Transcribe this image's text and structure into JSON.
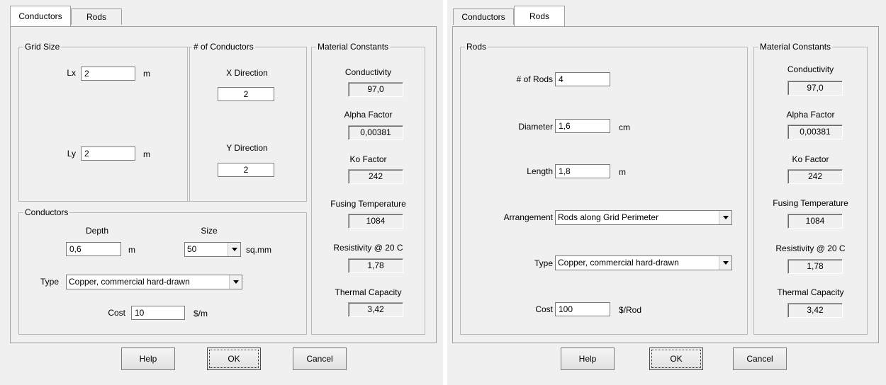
{
  "left_dialog": {
    "tabs": [
      "Conductors",
      "Rods"
    ],
    "grid_size": {
      "title": "Grid Size",
      "lx_label": "Lx",
      "lx_value": "2",
      "lx_unit": "m",
      "ly_label": "Ly",
      "ly_value": "2",
      "ly_unit": "m"
    },
    "num_conductors": {
      "title": "# of Conductors",
      "x_label": "X Direction",
      "x_value": "2",
      "y_label": "Y Direction",
      "y_value": "2"
    },
    "conductors": {
      "title": "Conductors",
      "depth_label": "Depth",
      "depth_value": "0,6",
      "depth_unit": "m",
      "size_label": "Size",
      "size_value": "50",
      "size_unit": "sq.mm",
      "type_label": "Type",
      "type_value": "Copper, commercial hard-drawn",
      "cost_label": "Cost",
      "cost_value": "10",
      "cost_unit": "$/m"
    },
    "buttons": {
      "help": "Help",
      "ok": "OK",
      "cancel": "Cancel"
    }
  },
  "right_dialog": {
    "tabs": [
      "Conductors",
      "Rods"
    ],
    "rods": {
      "title": "Rods",
      "num_label": "# of Rods",
      "num_value": "4",
      "diameter_label": "Diameter",
      "diameter_value": "1,6",
      "diameter_unit": "cm",
      "length_label": "Length",
      "length_value": "1,8",
      "length_unit": "m",
      "arrangement_label": "Arrangement",
      "arrangement_value": "Rods along Grid Perimeter",
      "type_label": "Type",
      "type_value": "Copper, commercial hard-drawn",
      "cost_label": "Cost",
      "cost_value": "100",
      "cost_unit": "$/Rod"
    },
    "buttons": {
      "help": "Help",
      "ok": "OK",
      "cancel": "Cancel"
    }
  },
  "material_constants": {
    "title": "Material Constants",
    "conductivity_label": "Conductivity",
    "conductivity_value": "97,0",
    "alpha_label": "Alpha Factor",
    "alpha_value": "0,00381",
    "ko_label": "Ko Factor",
    "ko_value": "242",
    "fusing_label": "Fusing Temperature",
    "fusing_value": "1084",
    "resistivity_label": "Resistivity @ 20 C",
    "resistivity_value": "1,78",
    "thermal_label": "Thermal  Capacity",
    "thermal_value": "3,42"
  }
}
